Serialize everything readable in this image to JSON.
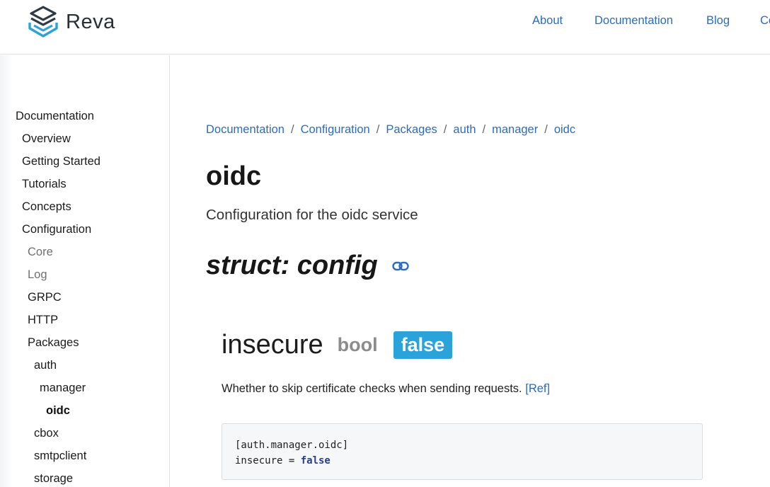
{
  "brand": {
    "name": "Reva"
  },
  "nav": {
    "links": [
      {
        "label": "About"
      },
      {
        "label": "Documentation"
      },
      {
        "label": "Blog"
      },
      {
        "label": "Co"
      }
    ]
  },
  "sidebar": {
    "items": [
      {
        "label": "Documentation"
      },
      {
        "label": "Overview"
      },
      {
        "label": "Getting Started"
      },
      {
        "label": "Tutorials"
      },
      {
        "label": "Concepts"
      },
      {
        "label": "Configuration"
      },
      {
        "label": "Core"
      },
      {
        "label": "Log"
      },
      {
        "label": "GRPC"
      },
      {
        "label": "HTTP"
      },
      {
        "label": "Packages"
      },
      {
        "label": "auth"
      },
      {
        "label": "manager"
      },
      {
        "label": "oidc"
      },
      {
        "label": "cbox"
      },
      {
        "label": "smtpclient"
      },
      {
        "label": "storage"
      }
    ]
  },
  "breadcrumb": {
    "items": [
      "Documentation",
      "Configuration",
      "Packages",
      "auth",
      "manager",
      "oidc"
    ],
    "separator": "/"
  },
  "page": {
    "title": "oidc",
    "subtitle": "Configuration for the oidc service",
    "struct_heading": "struct: config"
  },
  "field": {
    "name": "insecure",
    "type": "bool",
    "default": "false",
    "description": "Whether to skip certificate checks when sending requests.",
    "ref_label": "[Ref]"
  },
  "code": {
    "line1": "[auth.manager.oidc]",
    "line2_key": "insecure = ",
    "line2_value": "false"
  },
  "colors": {
    "link": "#2a6cc1",
    "badge": "#2aa3db",
    "logo_dark": "#2e3a45",
    "logo_accent": "#2aa3db"
  }
}
